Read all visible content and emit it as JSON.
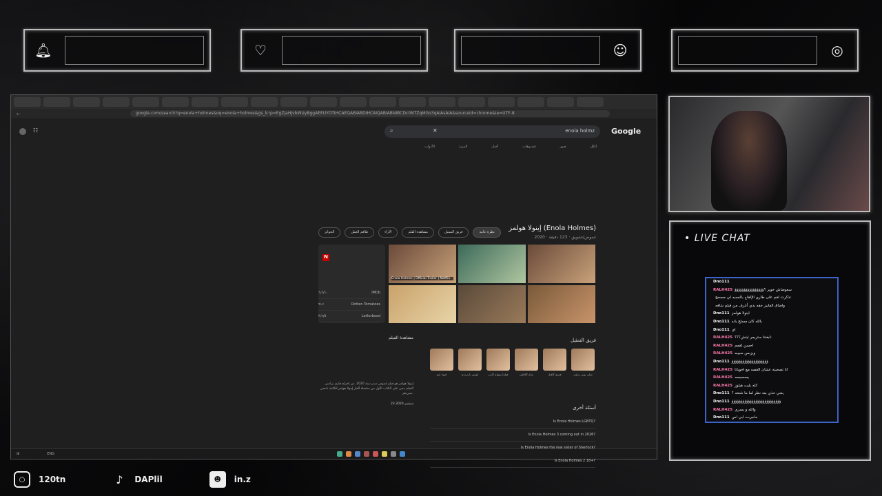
{
  "overlay": {
    "alert_icons": [
      "bell-icon",
      "heart-hand-icon",
      "user-check-icon",
      "coins-icon"
    ],
    "chat_title": "• LIVE CHAT",
    "socials": [
      {
        "icon": "instagram-icon",
        "label": "120tn"
      },
      {
        "icon": "tiktok-icon",
        "label": "DAPlil"
      },
      {
        "icon": "discord-icon",
        "label": "in.z"
      }
    ]
  },
  "browser": {
    "url": "google.com/search?q=enola+holmes&oq=enola+holmes&gs_lcrp=EgZjaHJvbWUyBggAEEUYOTIHCAEQABiABDIHCAIQABiABNIBCDc0NTZqMGo3qAIAsAIA&sourceid=chrome&ie=UTF-8",
    "search_query": "enola holmz",
    "logo": "Google",
    "nav_tabs": [
      "الأدوات",
      "المزيد",
      "أخبار",
      "فيديوهات",
      "صور",
      "الكل"
    ],
    "knowledge_title": "إينولا هولمز (Enola Holmes)",
    "knowledge_sub": "2020 ‧ غموض/تشويق ‧ 123 دقيقة",
    "pills": [
      "نظرة عامة",
      "فريق التمثيل",
      "مشاهدة الفلم",
      "الأراء",
      "طاقم العمل",
      "الجوائز"
    ],
    "netflix_title": "Enola Holmes | Official Trailer | Netflix",
    "ratings": [
      {
        "site": "IMDb",
        "value": "٦٫٦/١٠"
      },
      {
        "site": "Rotten Tomatoes",
        "value": "٩١٪"
      },
      {
        "site": "Letterboxd",
        "value": "٣٫٢/٥"
      }
    ],
    "cast_heading": "فريق التمثيل",
    "cast": [
      "ميلي بوبي براون",
      "هنري كافيل",
      "سام كلافلين",
      "هيلينا بونهام كارتر",
      "لويس بارتريدج",
      "فيونا شو"
    ],
    "faq_heading": "أسئلة أخرى",
    "faq": [
      "Is Enola Holmes LGBTQ?",
      "Is Enola Holmes 3 coming out in 2026?",
      "Is Enola Holmes the real sister of Sherlock?",
      "Is Enola Holmes 2 18+?"
    ],
    "watch_heading": "مشاهدة الفيلم",
    "description": "إينولا هولمز هو فيلم غموض صدر سنة 2020، من إخراج هاري برادبير. الفيلم مبني على الكتاب الأول من سلسلة ألغاز إينولا هولمز للكاتبة نانسي سبرينغر.",
    "release_date": "23 سبتمبر 2020",
    "taskbar_lang": "ENG"
  },
  "chat": [
    {
      "u": "Dno111",
      "t": "",
      "c": "u1"
    },
    {
      "u": "RALH425",
      "t": "سعوضاش خوير ؟ؤؤؤؤؤؤؤؤؤؤؤؤؤؤؤؤ",
      "c": "u2"
    },
    {
      "u": "",
      "t": "تذكرت لقم على طاري الإلقاح بالنسبه لي مسحج",
      "c": "u1"
    },
    {
      "u": "",
      "t": "واضاق الفايبز حقه يدي أعرف من فيلم شافه",
      "c": "u1"
    },
    {
      "u": "Dno111",
      "t": "اينولا هولمز",
      "c": "u1"
    },
    {
      "u": "Dno111",
      "t": "بالله كان مسلح يانه",
      "c": "u1"
    },
    {
      "u": "Dno111",
      "t": "اي",
      "c": "u1"
    },
    {
      "u": "RALH425",
      "t": "نابغتنا ستريمر ثيتش؟؟؟",
      "c": "u2"
    },
    {
      "u": "RALH425",
      "t": "احسن لقمم",
      "c": "u2"
    },
    {
      "u": "RALH425",
      "t": "ويزبس سبيبه",
      "c": "u2"
    },
    {
      "u": "Dno111",
      "t": "ؤؤؤؤؤؤؤؤؤؤؤؤؤؤؤؤؤؤؤؤ",
      "c": "u1"
    },
    {
      "u": "RALH425",
      "t": "انا تصحيته عشان القصه مع اخويانا",
      "c": "u2"
    },
    {
      "u": "RALH425",
      "t": "يسسبسه",
      "c": "u2"
    },
    {
      "u": "RALH425",
      "t": "كله بليت هيلوز",
      "c": "u2"
    },
    {
      "u": "Dno111",
      "t": "يعني خذي بعد نظر لما ما شفته ؟",
      "c": "u1"
    },
    {
      "u": "Dno111",
      "t": "ؤؤؤؤؤؤؤؤؤؤؤؤؤؤؤؤؤؤؤؤؤؤؤؤؤؤؤ",
      "c": "u1"
    },
    {
      "u": "RALH425",
      "t": "والله و يسري",
      "c": "u2"
    },
    {
      "u": "Dno111",
      "t": "ماجربت ابي اس",
      "c": "u1"
    }
  ]
}
